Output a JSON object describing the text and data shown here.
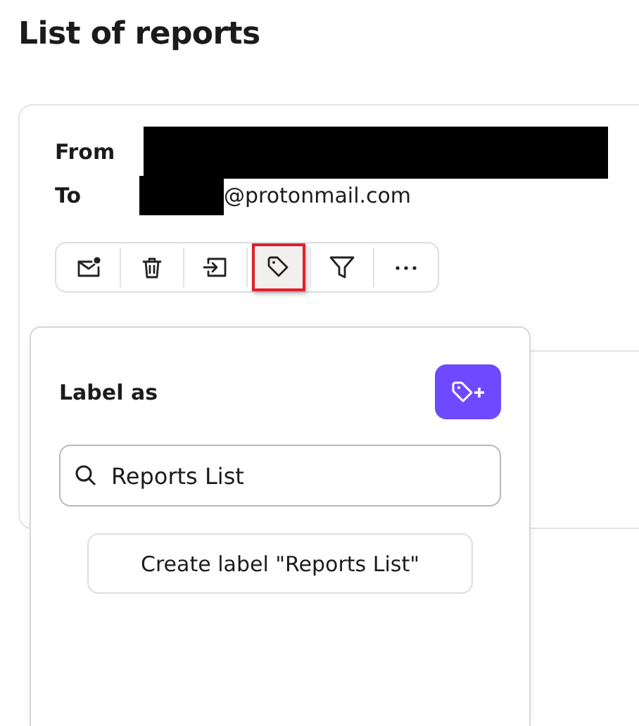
{
  "page_title": "List of reports",
  "message": {
    "from": {
      "label": "From",
      "redacted": true
    },
    "to": {
      "label": "To",
      "redacted": true,
      "address": "@protonmail.com"
    },
    "toolbar": [
      {
        "kind": "unread",
        "highlighted": false
      },
      {
        "kind": "trash",
        "highlighted": false
      },
      {
        "kind": "move",
        "highlighted": false
      },
      {
        "kind": "label",
        "highlighted": true
      },
      {
        "kind": "filter",
        "highlighted": false
      },
      {
        "kind": "more",
        "highlighted": false
      }
    ]
  },
  "label_popup": {
    "title": "Label as",
    "search": {
      "value": "Reports List"
    },
    "create_button": "Create label \"Reports List\""
  }
}
